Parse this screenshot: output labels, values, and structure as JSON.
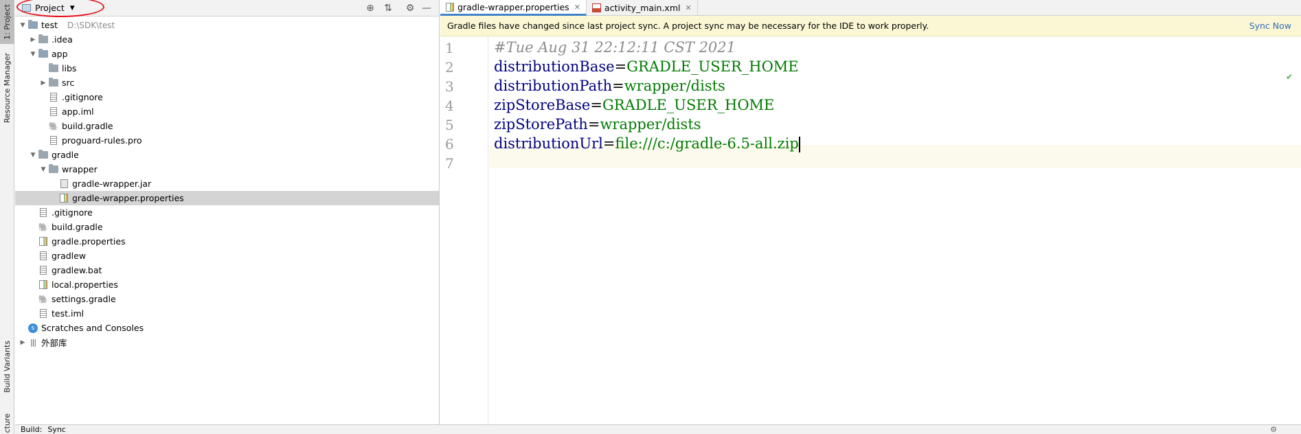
{
  "toolstrip": {
    "project_tab": "1: Project",
    "resource_manager_tab": "Resource Manager",
    "build_variants_tab": "Build Variants",
    "structure_tab": "cture"
  },
  "project_panel": {
    "view_selector_label": "Project",
    "tree": [
      {
        "name": "test",
        "detail": "D:\\SDK\\test",
        "depth": 0,
        "expanded": true,
        "icon": "module-folder-icon"
      },
      {
        "name": ".idea",
        "depth": 1,
        "expanded": false,
        "icon": "folder-icon"
      },
      {
        "name": "app",
        "depth": 1,
        "expanded": true,
        "icon": "module-folder-icon"
      },
      {
        "name": "libs",
        "depth": 2,
        "leaf": true,
        "icon": "folder-icon"
      },
      {
        "name": "src",
        "depth": 2,
        "expanded": false,
        "icon": "folder-icon"
      },
      {
        "name": ".gitignore",
        "depth": 2,
        "leaf": true,
        "icon": "text-file-icon"
      },
      {
        "name": "app.iml",
        "depth": 2,
        "leaf": true,
        "icon": "module-file-icon"
      },
      {
        "name": "build.gradle",
        "depth": 2,
        "leaf": true,
        "icon": "gradle-icon"
      },
      {
        "name": "proguard-rules.pro",
        "depth": 2,
        "leaf": true,
        "icon": "text-file-icon"
      },
      {
        "name": "gradle",
        "depth": 1,
        "expanded": true,
        "icon": "folder-icon"
      },
      {
        "name": "wrapper",
        "depth": 2,
        "expanded": true,
        "icon": "folder-icon"
      },
      {
        "name": "gradle-wrapper.jar",
        "depth": 3,
        "leaf": true,
        "icon": "jar-icon"
      },
      {
        "name": "gradle-wrapper.properties",
        "depth": 3,
        "leaf": true,
        "icon": "properties-icon",
        "selected": true
      },
      {
        "name": ".gitignore",
        "depth": 1,
        "leaf": true,
        "icon": "text-file-icon"
      },
      {
        "name": "build.gradle",
        "depth": 1,
        "leaf": true,
        "icon": "gradle-icon"
      },
      {
        "name": "gradle.properties",
        "depth": 1,
        "leaf": true,
        "icon": "properties-icon"
      },
      {
        "name": "gradlew",
        "depth": 1,
        "leaf": true,
        "icon": "text-file-icon"
      },
      {
        "name": "gradlew.bat",
        "depth": 1,
        "leaf": true,
        "icon": "text-file-icon"
      },
      {
        "name": "local.properties",
        "depth": 1,
        "leaf": true,
        "icon": "properties-icon"
      },
      {
        "name": "settings.gradle",
        "depth": 1,
        "leaf": true,
        "icon": "gradle-icon"
      },
      {
        "name": "test.iml",
        "depth": 1,
        "leaf": true,
        "icon": "module-file-icon"
      },
      {
        "name": "Scratches and Consoles",
        "depth": 0,
        "leaf": true,
        "icon": "scratches-icon"
      },
      {
        "name": "外部库",
        "depth": 0,
        "expanded": false,
        "icon": "library-icon"
      }
    ]
  },
  "editor": {
    "tabs": [
      {
        "label": "gradle-wrapper.properties",
        "active": true,
        "icon": "properties-icon"
      },
      {
        "label": "activity_main.xml",
        "active": false,
        "icon": "xml-file-icon"
      }
    ],
    "banner": {
      "message": "Gradle files have changed since last project sync. A project sync may be necessary for the IDE to work properly.",
      "action": "Sync Now"
    },
    "lines": [
      {
        "n": "1",
        "comment": "#Tue Aug 31 22:12:11 CST 2021"
      },
      {
        "n": "2",
        "key": "distributionBase",
        "value": "GRADLE_USER_HOME"
      },
      {
        "n": "3",
        "key": "distributionPath",
        "value": "wrapper/dists"
      },
      {
        "n": "4",
        "key": "zipStoreBase",
        "value": "GRADLE_USER_HOME"
      },
      {
        "n": "5",
        "key": "zipStorePath",
        "value": "wrapper/dists"
      },
      {
        "n": "6",
        "key": "distributionUrl",
        "value": "file:///c:/gradle-6.5-all.zip",
        "caret": true
      },
      {
        "n": "7"
      }
    ]
  },
  "bottom_bar": {
    "build_label": "Build:",
    "sync_label": "Sync"
  },
  "colors": {
    "accent": "#4083c9",
    "banner_bg": "#fbf7d5",
    "annotation_red": "#e8141b",
    "key_color": "#000080",
    "value_color": "#007a00"
  }
}
